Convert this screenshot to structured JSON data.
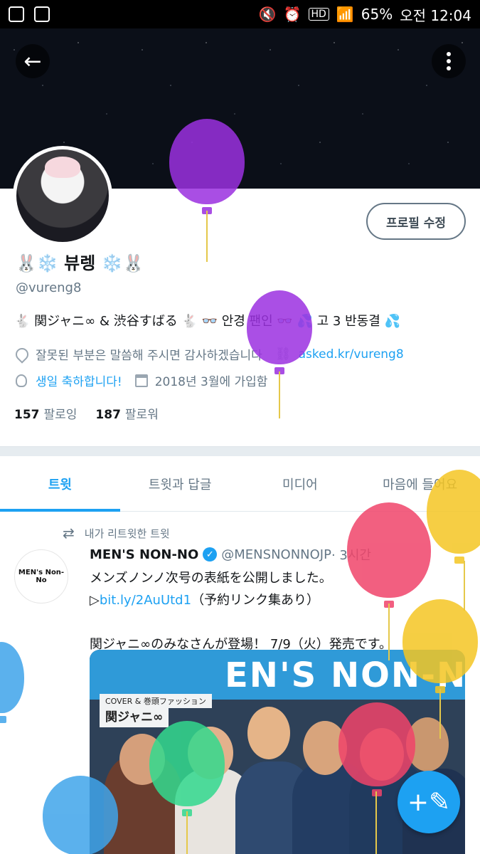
{
  "status_bar": {
    "battery": "65%",
    "time": "오전 12:04",
    "hd": "HD"
  },
  "header": {
    "back_icon": "←",
    "more_icon": "more-vertical-icon"
  },
  "profile": {
    "edit_button": "프로필 수정",
    "name": "🐰❄️ 뷰렝 ❄️🐰",
    "handle": "@vureng8",
    "bio": "🐇 関ジャニ∞ & 渋谷すばる 🐇 👓 안경 팬인 👓 💦 고 3 반동결 💦",
    "location": "잘못된 부분은 말씀해 주시면 감사하겠습니다",
    "website": "asked.kr/vureng8",
    "birthday": "생일 축하합니다!",
    "joined": "2018년 3월에 가입함",
    "following_count": "157",
    "following_label": "팔로잉",
    "followers_count": "187",
    "followers_label": "팔로워"
  },
  "tabs": [
    {
      "label": "트윗",
      "active": true
    },
    {
      "label": "트윗과 답글",
      "active": false
    },
    {
      "label": "미디어",
      "active": false
    },
    {
      "label": "마음에 들어요",
      "active": false
    }
  ],
  "tweet": {
    "retweet_label": "내가 리트윗한 트윗",
    "author_name": "MEN'S NON-NO",
    "author_handle": "@MENSNONNOJP",
    "time": "· 3시간",
    "avatar_text": "MEN's Non-No",
    "line1": "メンズノンノ次号の表紙を公開しました。",
    "line2_prefix": "▷",
    "line2_link": "bit.ly/2AuUtd1",
    "line2_suffix": "（予約リンク集あり）",
    "line3": "関ジャニ∞のみなさんが登場！ 7/9（火）発売です。",
    "media_title": "EN'S NON-NO",
    "media_sub": "COVER & 巻頭ファッション",
    "media_sub2": "関ジャニ∞"
  },
  "fab": {
    "label": "+✎"
  },
  "colors": {
    "accent": "#1da1f2",
    "text": "#14171a",
    "muted": "#657786"
  }
}
